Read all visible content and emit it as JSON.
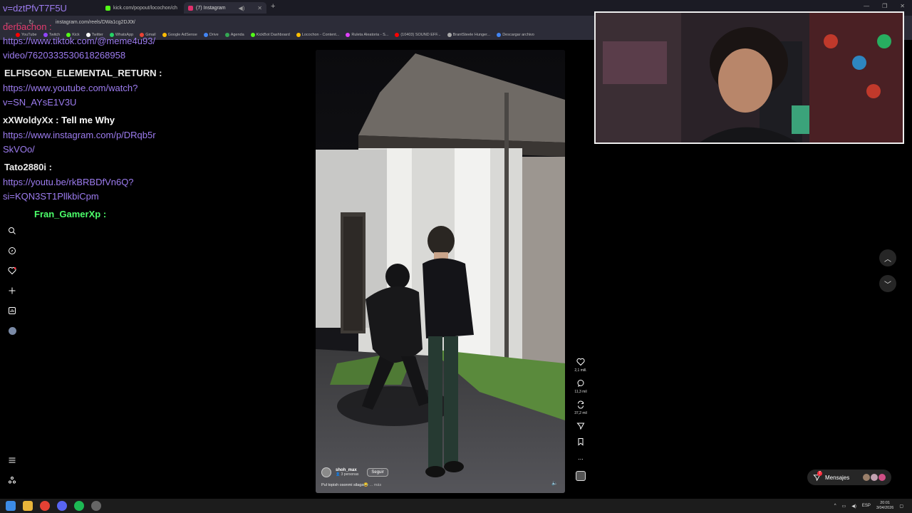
{
  "browser": {
    "tabs": [
      {
        "label": "kick.com/popout/locochon/ch",
        "icon_color": "#53fc18"
      },
      {
        "label": "(7) Instagram",
        "icon_color": "#e1306c"
      }
    ],
    "url": "instagram.com/reels/DWa1cg2DJ0t/",
    "bookmarks": [
      {
        "label": "YouTube",
        "color": "#ff0000"
      },
      {
        "label": "Twitch",
        "color": "#9146ff"
      },
      {
        "label": "Kick",
        "color": "#53fc18"
      },
      {
        "label": "Twitter",
        "color": "#ffffff"
      },
      {
        "label": "WhatsApp",
        "color": "#25d366"
      },
      {
        "label": "Gmail",
        "color": "#ea4335"
      },
      {
        "label": "Google AdSense",
        "color": "#fbbc04"
      },
      {
        "label": "Drive",
        "color": "#4285f4"
      },
      {
        "label": "Agenda",
        "color": "#34a853"
      },
      {
        "label": "KickBot Dashboard",
        "color": "#53fc18"
      },
      {
        "label": "Locochon - Content...",
        "color": "#ffbf00"
      },
      {
        "label": "Ruleta Aleatoria - S...",
        "color": "#e040fb"
      },
      {
        "label": "(10403) SOUND EFF...",
        "color": "#ff0000"
      },
      {
        "label": "BrantSteele Hunger...",
        "color": "#aaaaaa"
      },
      {
        "label": "Descargar archivo",
        "color": "#4285f4"
      }
    ]
  },
  "chat": {
    "lines": [
      {
        "text": "v=dztPfvT7F5U",
        "kind": "link"
      },
      {
        "text": "derbachon :",
        "kind": "red"
      },
      {
        "text": "https://www.tiktok.com/@meme4u93/",
        "kind": "link"
      },
      {
        "text": "video/7620333530618268958",
        "kind": "link"
      },
      {
        "text": "ELFISGON_ELEMENTAL_RETURN :",
        "kind": "user"
      },
      {
        "text": "https://www.youtube.com/watch?",
        "kind": "link"
      },
      {
        "text": "v=SN_AYsE1V3U",
        "kind": "link"
      },
      {
        "user": "xXWoldyXx",
        "text": "Tell me Why",
        "kind": "usermsg"
      },
      {
        "text": "https://www.instagram.com/p/DRqb5r",
        "kind": "link"
      },
      {
        "text": "SkVOo/",
        "kind": "link"
      },
      {
        "text": "Tato2880i :",
        "kind": "user"
      },
      {
        "text": "https://youtu.be/rkBRBDfVn6Q?",
        "kind": "link"
      },
      {
        "text": "si=KQN3ST1PllkbiCpm",
        "kind": "link"
      },
      {
        "text": "Fran_GamerXp :",
        "kind": "green"
      }
    ]
  },
  "reel": {
    "username": "shoh_max",
    "followers": "3 personas",
    "follow_label": "Seguir",
    "caption": "Pul topish osonmi silaga😂",
    "more_label": "... más",
    "likes": "2,1 mill.",
    "comments": "11,3 mil",
    "reposts": "37,2 mil",
    "more_dots": "..."
  },
  "messages": {
    "label": "Mensajes",
    "badge": "7"
  },
  "taskbar": {
    "lang": "ESP",
    "time": "20:01",
    "date": "3/04/2026"
  }
}
